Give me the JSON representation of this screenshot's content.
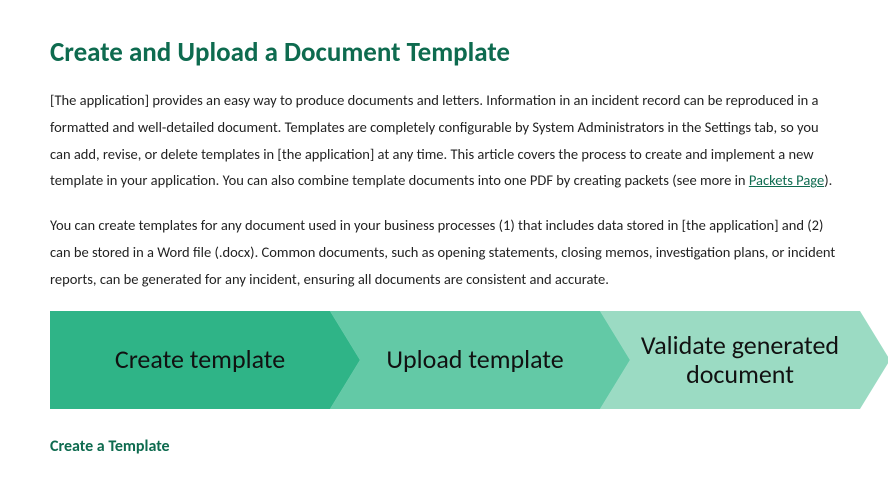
{
  "title": "Create and Upload a Document Template",
  "paragraph1": {
    "pre": "[The application] provides an easy way to produce documents and letters. Information in an incident record can be reproduced in a formatted and well-detailed document. Templates are completely configurable by System Administrators in the Settings tab, so you can add, revise, or delete templates in [the application] at any time. This article covers the process to create and implement a new template in your application. You can also combine template documents into one PDF by creating packets (see more in ",
    "link": "Packets Page",
    "post": ")."
  },
  "paragraph2": "You can create templates for any document used in your business processes (1) that includes data stored in [the application] and (2) can be stored in a Word file (.docx). Common documents, such as opening statements, closing memos, investigation plans, or incident reports, can be generated for any incident, ensuring all documents are consistent and accurate.",
  "flow": {
    "step1_label": "Create template",
    "step2_label": "Upload template",
    "step3_label": "Validate generated document",
    "step1_color": "#2fb487",
    "step2_color": "#63c9a6",
    "step3_color": "#9bdbc3"
  },
  "section_heading": "Create a Template"
}
